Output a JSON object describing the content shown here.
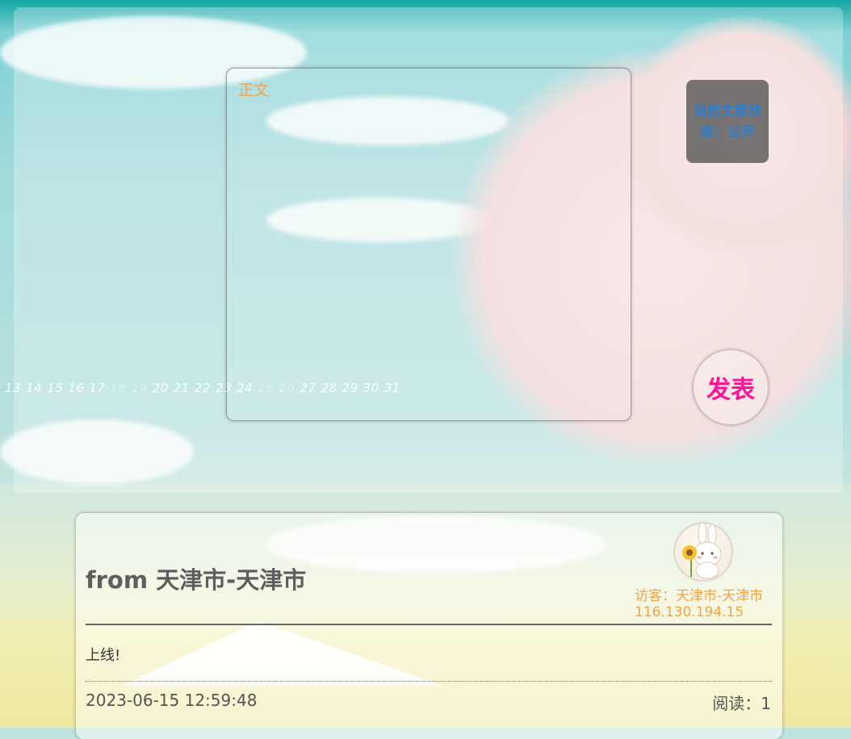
{
  "editor": {
    "content_placeholder": "正文",
    "status_text": "当前文章状态：公开",
    "publish_label": "发表",
    "date_strip": [
      {
        "label": "13",
        "dim": false
      },
      {
        "label": "14",
        "dim": false
      },
      {
        "label": "15",
        "dim": false
      },
      {
        "label": "16",
        "dim": false
      },
      {
        "label": "17",
        "dim": false
      },
      {
        "label": "18",
        "dim": true
      },
      {
        "label": "19",
        "dim": true
      },
      {
        "label": "20",
        "dim": false
      },
      {
        "label": "21",
        "dim": false
      },
      {
        "label": "22",
        "dim": false
      },
      {
        "label": "23",
        "dim": false
      },
      {
        "label": "24",
        "dim": false
      },
      {
        "label": "25",
        "dim": true
      },
      {
        "label": "26",
        "dim": true
      },
      {
        "label": "27",
        "dim": false
      },
      {
        "label": "28",
        "dim": false
      },
      {
        "label": "29",
        "dim": false
      },
      {
        "label": "30",
        "dim": false
      },
      {
        "label": "31",
        "dim": false
      }
    ]
  },
  "message": {
    "title": "from 天津市-天津市",
    "visitor_location": "访客：天津市-天津市",
    "visitor_ip": "116.130.194.15",
    "body": "上线!",
    "timestamp": "2023-06-15 12:59:48",
    "reads": "阅读：1"
  },
  "colors": {
    "accent_orange": "#f0a44c",
    "status_blue": "#2b7fd1",
    "publish_pink": "#ff1493"
  },
  "icons": {
    "avatar": "rabbit-with-sunflower-avatar"
  }
}
